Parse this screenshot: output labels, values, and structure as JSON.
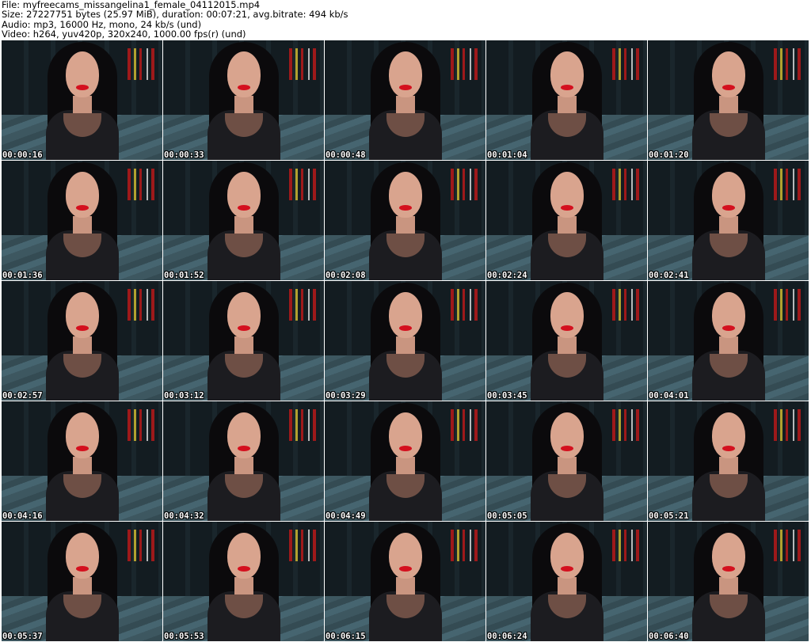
{
  "header": {
    "file": "File: myfreecams_missangelina1_female_04112015.mp4",
    "size": "Size: 27227751 bytes (25.97 MiB), duration: 00:07:21, avg.bitrate: 494 kb/s",
    "audio": "Audio: mp3, 16000 Hz, mono, 24 kb/s (und)",
    "video": "Video: h264, yuv420p, 320x240, 1000.00 fps(r) (und)"
  },
  "thumbnails": [
    {
      "timestamp": "00:00:16"
    },
    {
      "timestamp": "00:00:33"
    },
    {
      "timestamp": "00:00:48"
    },
    {
      "timestamp": "00:01:04"
    },
    {
      "timestamp": "00:01:20"
    },
    {
      "timestamp": "00:01:36"
    },
    {
      "timestamp": "00:01:52"
    },
    {
      "timestamp": "00:02:08"
    },
    {
      "timestamp": "00:02:24"
    },
    {
      "timestamp": "00:02:41"
    },
    {
      "timestamp": "00:02:57"
    },
    {
      "timestamp": "00:03:12"
    },
    {
      "timestamp": "00:03:29"
    },
    {
      "timestamp": "00:03:45"
    },
    {
      "timestamp": "00:04:01"
    },
    {
      "timestamp": "00:04:16"
    },
    {
      "timestamp": "00:04:32"
    },
    {
      "timestamp": "00:04:49"
    },
    {
      "timestamp": "00:05:05"
    },
    {
      "timestamp": "00:05:21"
    },
    {
      "timestamp": "00:05:37"
    },
    {
      "timestamp": "00:05:53"
    },
    {
      "timestamp": "00:06:15"
    },
    {
      "timestamp": "00:06:24"
    },
    {
      "timestamp": "00:06:40"
    }
  ],
  "colors": {
    "lips": "#d4101e",
    "background": "#ffffff",
    "timestamp_text": "#ffffff"
  }
}
